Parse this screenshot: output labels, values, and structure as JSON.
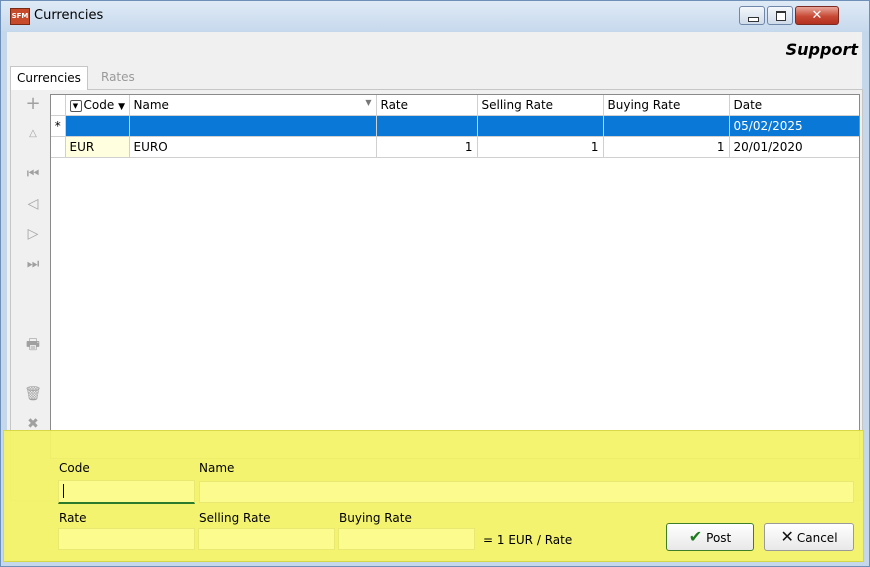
{
  "window": {
    "title": "Currencies",
    "app_icon_text": "SFM"
  },
  "header": {
    "section": "Support"
  },
  "tabs": [
    {
      "label": "Currencies"
    },
    {
      "label": "Rates"
    }
  ],
  "toolbar": {
    "icons": [
      "add-icon",
      "up-icon",
      "first-icon",
      "prev-icon",
      "next-icon",
      "last-icon",
      "print-icon",
      "delete-icon",
      "cancel-edit-icon"
    ]
  },
  "grid": {
    "columns": [
      "Code",
      "Name",
      "Rate",
      "Selling Rate",
      "Buying Rate",
      "Date"
    ],
    "rows": [
      {
        "indicator": "*",
        "code": "",
        "name": "",
        "rate": "",
        "selling_rate": "",
        "buying_rate": "",
        "date": "05/02/2025"
      },
      {
        "indicator": "",
        "code": "EUR",
        "name": "EURO",
        "rate": "1",
        "selling_rate": "1",
        "buying_rate": "1",
        "date": "20/01/2020"
      }
    ]
  },
  "form": {
    "code_label": "Code",
    "name_label": "Name",
    "rate_label": "Rate",
    "selling_rate_label": "Selling Rate",
    "buying_rate_label": "Buying Rate",
    "hint": "= 1 EUR / Rate",
    "post_label": "Post",
    "cancel_label": "Cancel"
  }
}
